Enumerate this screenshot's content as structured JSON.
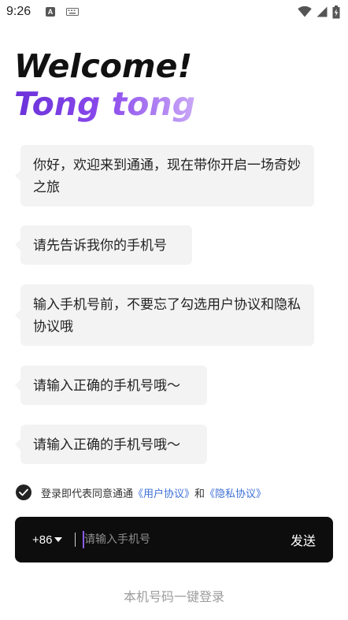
{
  "status_bar": {
    "time": "9:26",
    "icons": [
      "a-notification-icon",
      "keyboard-icon",
      "wifi-icon",
      "cellular-signal-icon",
      "battery-icon"
    ]
  },
  "header": {
    "welcome": "Welcome!",
    "name": "Tong tong",
    "gradient_colors": [
      "#6a32d9",
      "#c9a8f7"
    ]
  },
  "chat": {
    "messages": [
      "你好，欢迎来到通通，现在带你开启一场奇妙之旅",
      "请先告诉我你的手机号",
      "输入手机号前，不要忘了勾选用户协议和隐私协议哦",
      "请输入正确的手机号哦～",
      "请输入正确的手机号哦～"
    ]
  },
  "agreement": {
    "checked": true,
    "prefix": "登录即代表同意通通",
    "user_agreement": "《用户协议》",
    "connector": "和",
    "privacy_agreement": "《隐私协议》",
    "link_color": "#3d6fd8"
  },
  "login": {
    "country_code": "+86",
    "phone_placeholder": "请输入手机号",
    "phone_value": "",
    "send_label": "发送",
    "one_click_login": "本机号码一键登录"
  }
}
